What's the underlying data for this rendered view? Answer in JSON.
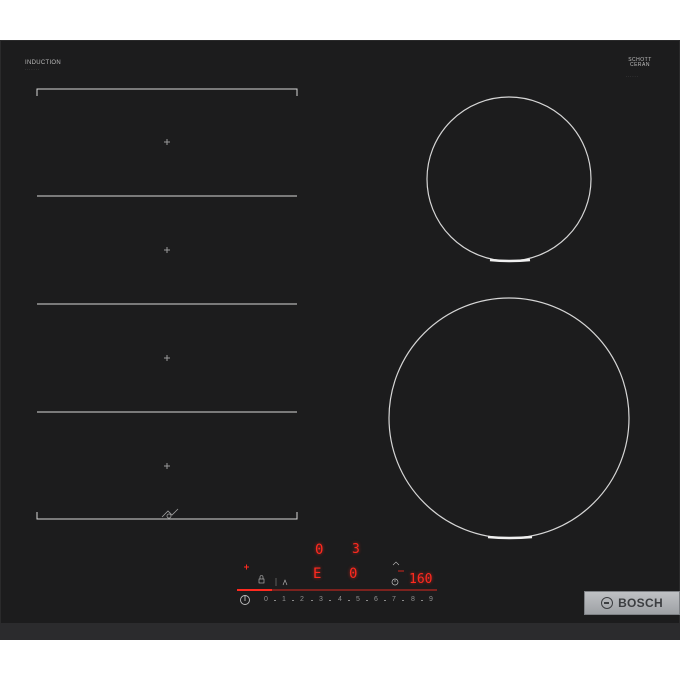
{
  "brand": {
    "top_left_label": "INDUCTION",
    "top_right_label": "SCHOTT CERAN",
    "maker": "BOSCH"
  },
  "display": {
    "left_timer_digit": "0",
    "right_timer_text": "3",
    "center_left_digits": "E",
    "center_right_digit": "0",
    "clock_value": "160"
  },
  "power_scale": [
    "0",
    "1",
    "2",
    "3",
    "4",
    "5",
    "6",
    "7",
    "8",
    "9"
  ],
  "icons": [
    "zone-cross-icon",
    "flex-zone-icon",
    "power-on-icon",
    "timer-icon",
    "lock-icon",
    "boost-icon"
  ],
  "colors": {
    "glass": "#1c1c1d",
    "led": "#ff2a1f",
    "zone_line": "#d8d8d8",
    "badge": "#b0b3b6"
  }
}
